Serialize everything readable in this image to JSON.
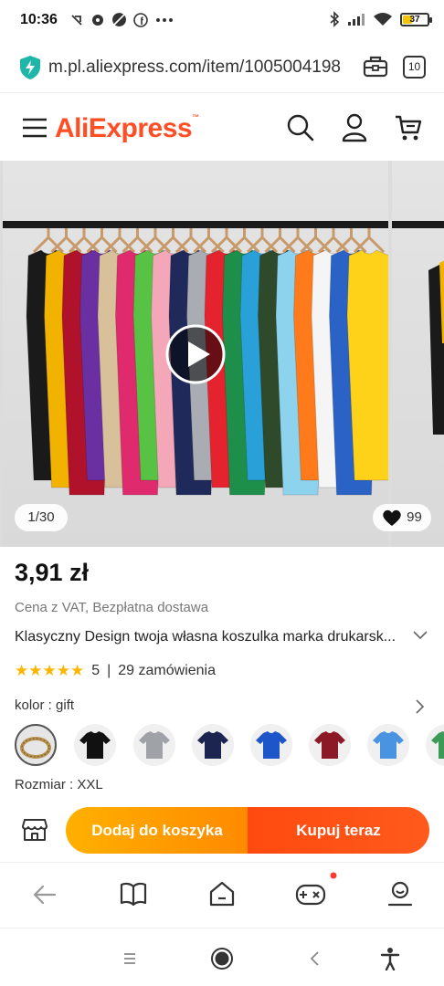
{
  "status_bar": {
    "time": "10:36",
    "battery": "37",
    "icons": [
      "screen-record-icon",
      "vpn-icon",
      "dnd-icon",
      "facebook-icon",
      "more-dots-icon",
      "bluetooth-icon",
      "signal-icon",
      "wifi-icon",
      "battery-icon"
    ]
  },
  "browser": {
    "url": "m.pl.aliexpress.com/item/1005004198",
    "tab_count": "10"
  },
  "site": {
    "logo_text": "AliExpress",
    "logo_mark": "™",
    "brand_color": "#ff4d24"
  },
  "gallery": {
    "counter": "1/30",
    "likes": "99",
    "shirt_colors": [
      "#1a1a1a",
      "#f2b300",
      "#b0122c",
      "#6a2fa0",
      "#d8c09a",
      "#e02a6e",
      "#57c244",
      "#f4a7b9",
      "#1f2a5a",
      "#a9adb3",
      "#e5232e",
      "#1e8f4a",
      "#2aa0d8",
      "#2f4a2a",
      "#8ed3ee",
      "#ff7a1a",
      "#f5f5f5",
      "#2b62c6",
      "#ffd21a"
    ]
  },
  "product": {
    "price": "3,91 zł",
    "price_note": "Cena z VAT, Bezpłatna dostawa",
    "title": "Klasyczny Design twoja własna koszulka marka drukarsk...",
    "rating": "5",
    "separator": "|",
    "orders": "29 zamówienia",
    "color_label": "kolor : gift",
    "size_label": "Rozmiar : XXL",
    "swatches": [
      {
        "name": "gift",
        "color": "#c9a060"
      },
      {
        "name": "black",
        "color": "#111111"
      },
      {
        "name": "grey",
        "color": "#9fa3a8"
      },
      {
        "name": "navy",
        "color": "#1c2550"
      },
      {
        "name": "blue",
        "color": "#1e55c8"
      },
      {
        "name": "burgundy",
        "color": "#8c1a26"
      },
      {
        "name": "light-blue",
        "color": "#4a93e0"
      },
      {
        "name": "green",
        "color": "#3c9a57"
      }
    ]
  },
  "actions": {
    "add_to_cart": "Dodaj do koszyka",
    "buy_now": "Kupuj teraz"
  }
}
